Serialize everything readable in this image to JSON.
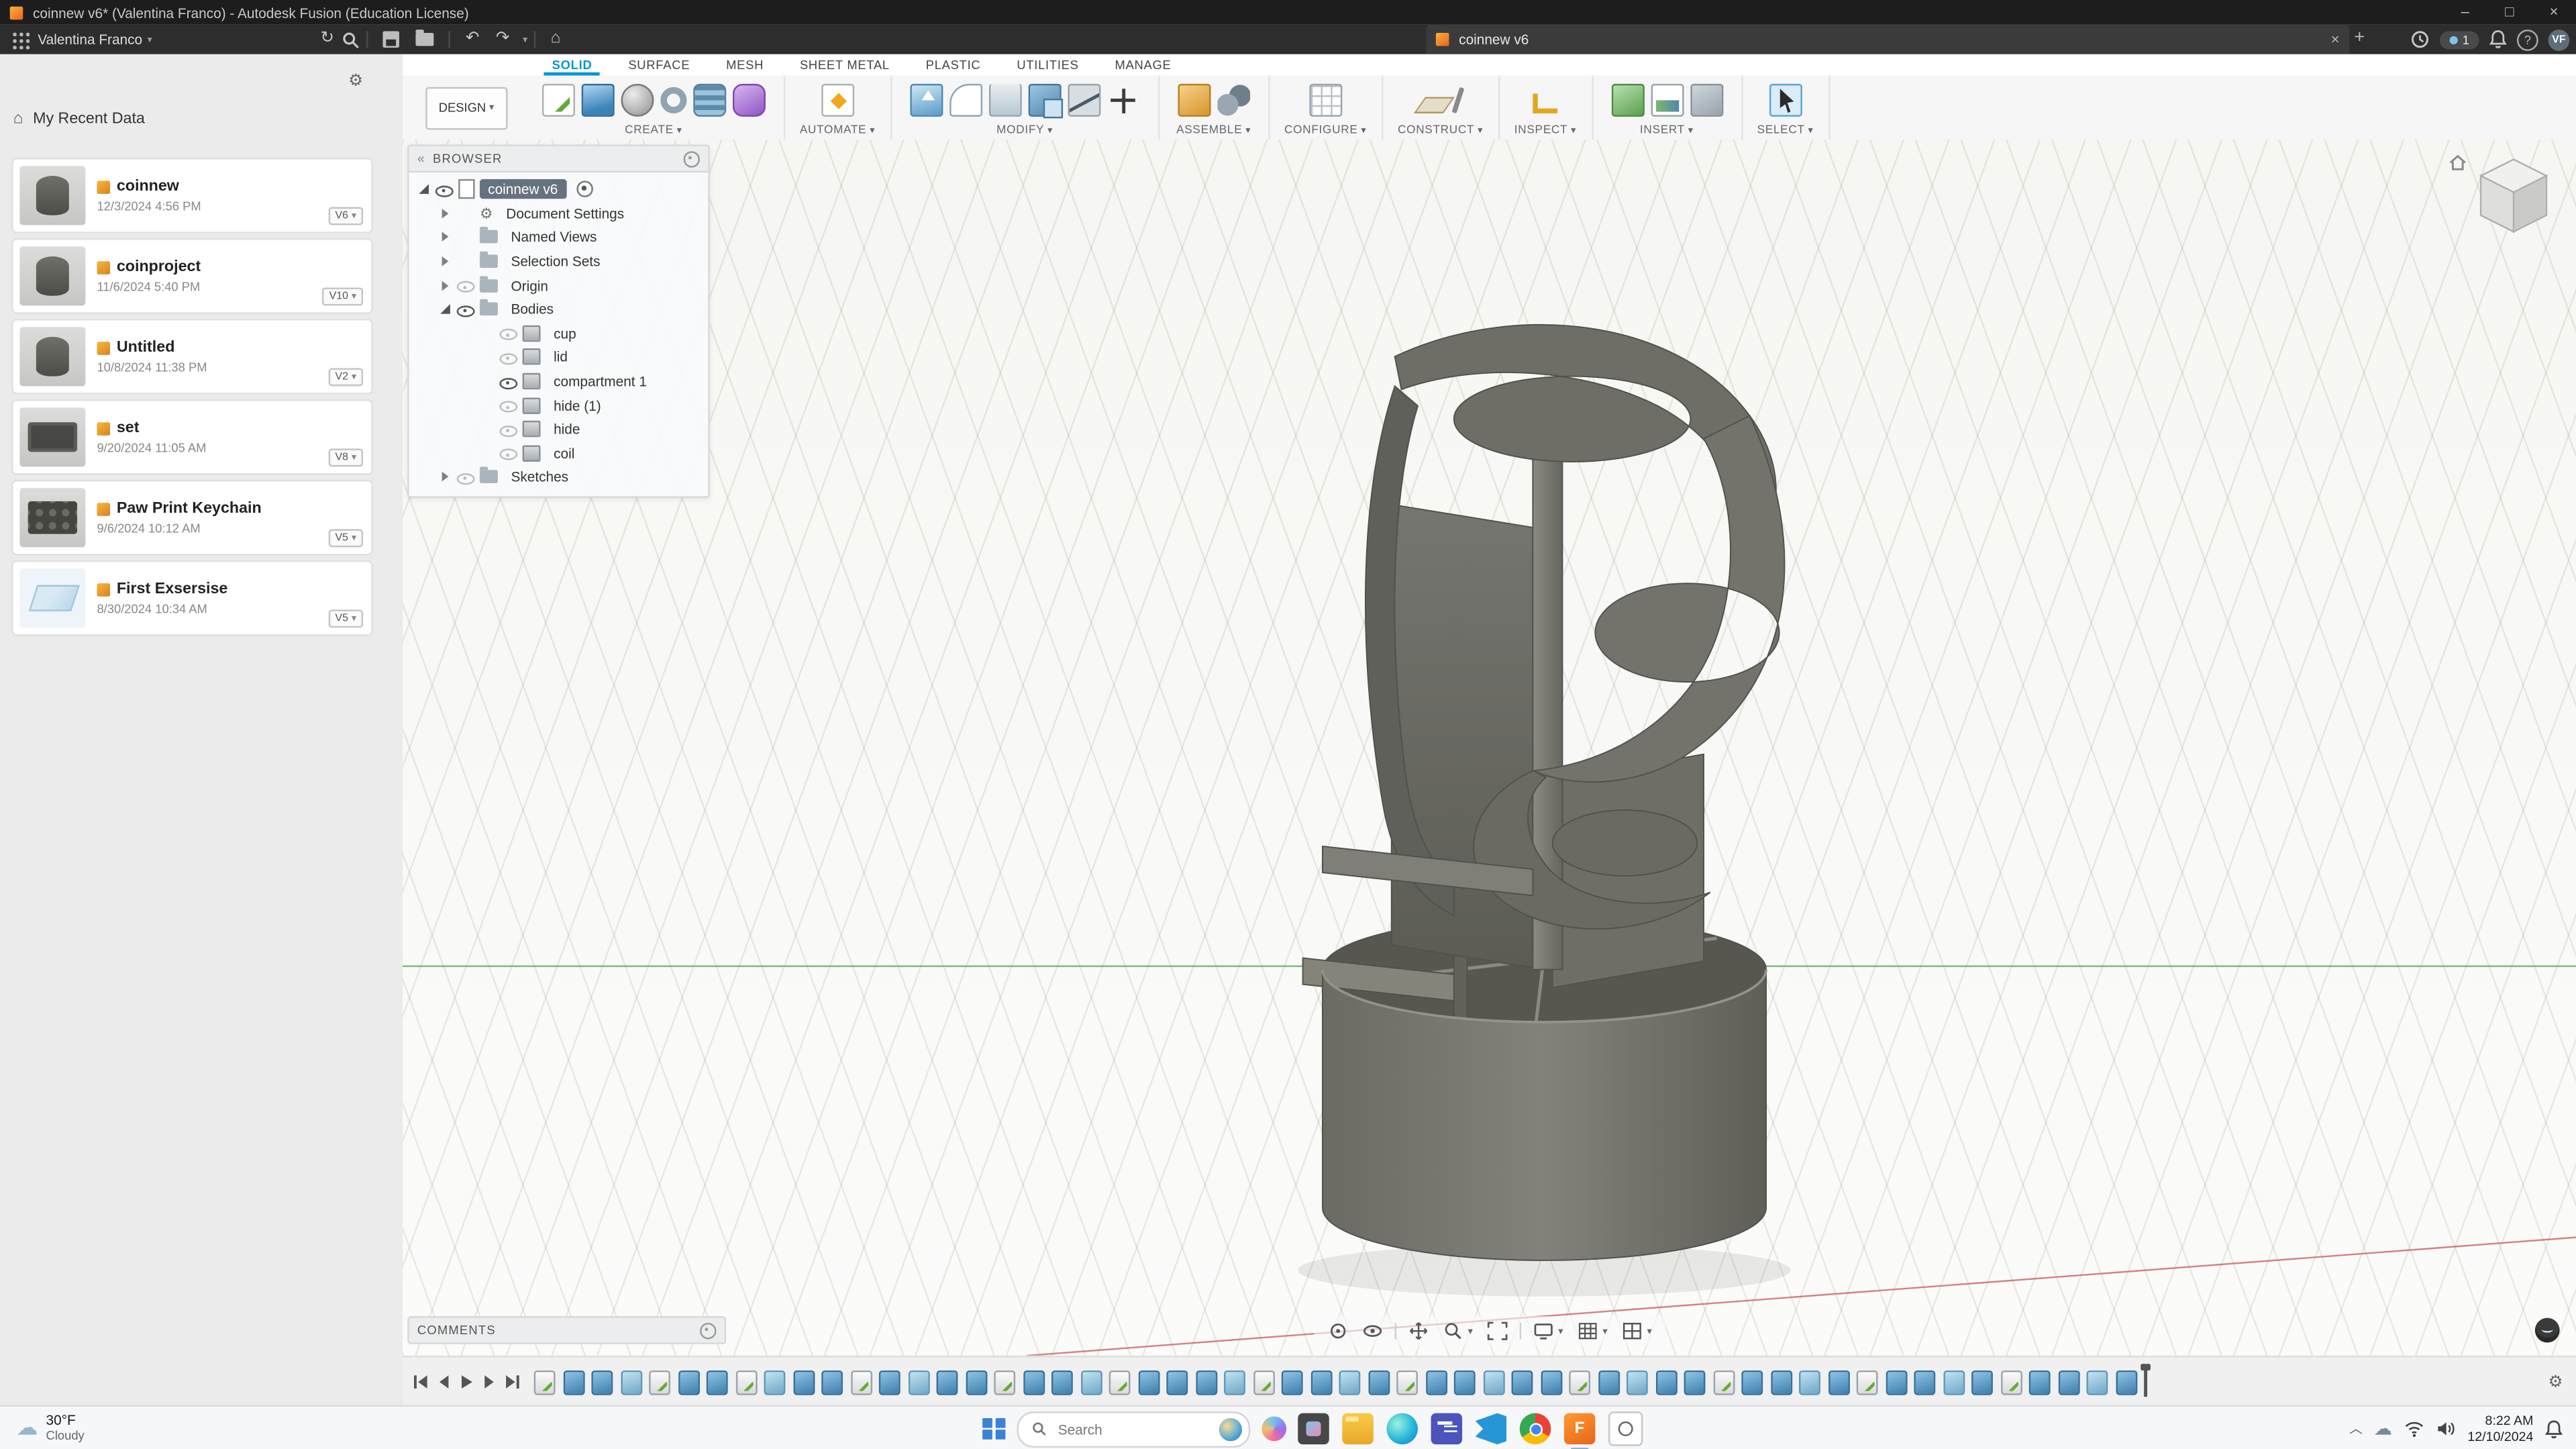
{
  "window": {
    "title": "coinnew v6* (Valentina Franco) - Autodesk Fusion (Education License)"
  },
  "appbar": {
    "user": "Valentina Franco",
    "doc_tab": "coinnew v6",
    "job_badge": "1",
    "avatar": "VF"
  },
  "data_panel": {
    "title": "My Recent Data",
    "items": [
      {
        "name": "coinnew",
        "date": "12/3/2024 4:56 PM",
        "version": "V6",
        "thumb": "cylinder"
      },
      {
        "name": "coinproject",
        "date": "11/6/2024 5:40 PM",
        "version": "V10",
        "thumb": "cylinder"
      },
      {
        "name": "Untitled",
        "date": "10/8/2024 11:38 PM",
        "version": "V2",
        "thumb": "cylinder"
      },
      {
        "name": "set",
        "date": "9/20/2024 11:05 AM",
        "version": "V8",
        "thumb": "tray"
      },
      {
        "name": "Paw Print Keychain",
        "date": "9/6/2024 10:12 AM",
        "version": "V5",
        "thumb": "paw"
      },
      {
        "name": "First Exsersise",
        "date": "8/30/2024 10:34 AM",
        "version": "V5",
        "thumb": "sketch"
      }
    ]
  },
  "ribbon": {
    "design_menu": "DESIGN",
    "tabs": [
      {
        "label": "SOLID",
        "active": true
      },
      {
        "label": "SURFACE"
      },
      {
        "label": "MESH"
      },
      {
        "label": "SHEET METAL"
      },
      {
        "label": "PLASTIC"
      },
      {
        "label": "UTILITIES"
      },
      {
        "label": "MANAGE"
      }
    ],
    "groups": [
      {
        "label": "CREATE",
        "icons": [
          "create-sketch-icon",
          "extrude-icon",
          "revolve-icon",
          "sweep-icon",
          "coil-icon",
          "form-icon"
        ]
      },
      {
        "label": "AUTOMATE",
        "icons": [
          "automate-icon"
        ]
      },
      {
        "label": "MODIFY",
        "icons": [
          "press-pull-icon",
          "fillet-icon",
          "shell-icon",
          "combine-icon",
          "split-icon",
          "move-icon"
        ]
      },
      {
        "label": "ASSEMBLE",
        "icons": [
          "new-component-icon",
          "joint-icon"
        ]
      },
      {
        "label": "CONFIGURE",
        "icons": [
          "configure-icon"
        ]
      },
      {
        "label": "CONSTRUCT",
        "icons": [
          "plane-icon",
          "axis-icon"
        ]
      },
      {
        "label": "INSPECT",
        "icons": [
          "measure-icon"
        ]
      },
      {
        "label": "INSERT",
        "icons": [
          "insert-mesh-icon",
          "decal-icon",
          "canvas-icon"
        ]
      },
      {
        "label": "SELECT",
        "icons": [
          "select-icon"
        ]
      }
    ]
  },
  "browser": {
    "header": "BROWSER",
    "rows": [
      {
        "label": "coinnew v6",
        "level": 0,
        "expander": "open",
        "eye": "on",
        "icon": "document",
        "selected": true
      },
      {
        "label": "Document Settings",
        "level": 1,
        "expander": "closed",
        "icon": "gear"
      },
      {
        "label": "Named Views",
        "level": 1,
        "expander": "closed",
        "icon": "folder"
      },
      {
        "label": "Selection Sets",
        "level": 1,
        "expander": "closed",
        "icon": "folder"
      },
      {
        "label": "Origin",
        "level": 1,
        "expander": "closed",
        "eye": "dim",
        "icon": "folder"
      },
      {
        "label": "Bodies",
        "level": 1,
        "expander": "open",
        "eye": "on",
        "icon": "folder"
      },
      {
        "label": "cup",
        "level": 2,
        "eye": "dim",
        "icon": "body"
      },
      {
        "label": "lid",
        "level": 2,
        "eye": "dim",
        "icon": "body"
      },
      {
        "label": "compartment 1",
        "level": 2,
        "eye": "on",
        "icon": "body"
      },
      {
        "label": "hide (1)",
        "level": 2,
        "eye": "dim",
        "icon": "body"
      },
      {
        "label": "hide",
        "level": 2,
        "eye": "dim",
        "icon": "body"
      },
      {
        "label": "coil",
        "level": 2,
        "eye": "dim",
        "icon": "body"
      },
      {
        "label": "Sketches",
        "level": 1,
        "expander": "closed",
        "eye": "dim",
        "icon": "folder"
      }
    ]
  },
  "viewport": {
    "comments_label": "COMMENTS",
    "nav_icons": [
      "orbit-icon",
      "look-at-icon",
      "pan-icon",
      "zoom-icon",
      "fit-icon",
      "display-settings-icon",
      "grid-settings-icon",
      "viewports-icon"
    ]
  },
  "timeline": {
    "features": [
      "sk",
      "ex",
      "ex",
      "fi",
      "sk",
      "ex",
      "ex",
      "sk",
      "fi",
      "ex",
      "ex",
      "sk",
      "ex",
      "fi",
      "ex",
      "ex",
      "sk",
      "ex",
      "ex",
      "fi",
      "sk",
      "ex",
      "ex",
      "ex",
      "fi",
      "sk",
      "ex",
      "ex",
      "fi",
      "ex",
      "sk",
      "ex",
      "ex",
      "fi",
      "ex",
      "ex",
      "sk",
      "ex",
      "fi",
      "ex",
      "ex",
      "sk",
      "ex",
      "ex",
      "fi",
      "ex",
      "sk",
      "ex",
      "ex",
      "fi",
      "ex",
      "sk",
      "ex",
      "ex",
      "fi",
      "ex"
    ]
  },
  "taskbar": {
    "weather": {
      "temp": "30°F",
      "condition": "Cloudy"
    },
    "search_placeholder": "Search",
    "apps": [
      {
        "name": "photos"
      },
      {
        "name": "file-explorer"
      },
      {
        "name": "edge"
      },
      {
        "name": "teams"
      },
      {
        "name": "vscode"
      },
      {
        "name": "chrome"
      },
      {
        "name": "fusion",
        "letter": "F",
        "active": true
      },
      {
        "name": "snipping"
      }
    ],
    "clock": {
      "time": "8:22 AM",
      "date": "12/10/2024"
    }
  }
}
